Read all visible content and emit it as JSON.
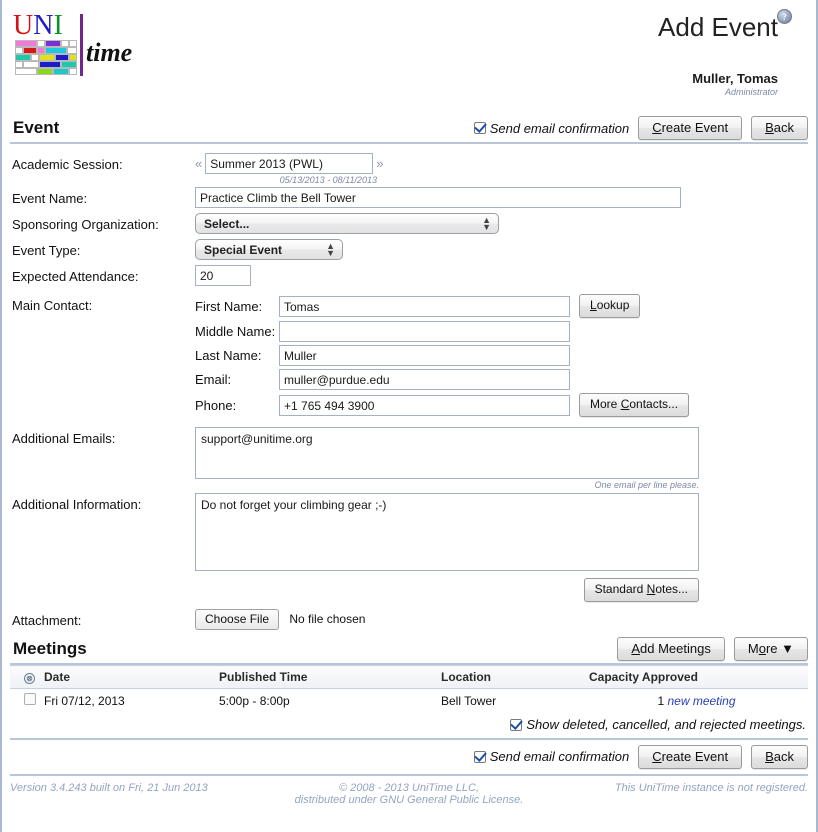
{
  "header": {
    "logo_uni": [
      "U",
      "N",
      "I"
    ],
    "logo_time": "time",
    "page_title": "Add Event",
    "help_icon_glyph": "?",
    "user_name": "Muller, Tomas",
    "user_role": "Administrator"
  },
  "event_section": {
    "title": "Event",
    "send_email_label": "Send email confirmation",
    "send_email_checked": true,
    "create_button": "Create Event",
    "create_button_accel": "C",
    "back_button": "Back",
    "back_button_accel": "B"
  },
  "form": {
    "academic_session": {
      "label": "Academic Session:",
      "value": "Summer 2013 (PWL)",
      "prev_glyph": "«",
      "next_glyph": "»",
      "dates": "05/13/2013 - 08/11/2013"
    },
    "event_name": {
      "label": "Event Name:",
      "value": "Practice Climb the Bell Tower"
    },
    "sponsoring_org": {
      "label": "Sponsoring Organization:",
      "value": "Select..."
    },
    "event_type": {
      "label": "Event Type:",
      "value": "Special Event"
    },
    "expected_attendance": {
      "label": "Expected Attendance:",
      "value": "20"
    },
    "main_contact": {
      "label": "Main Contact:",
      "first_name_label": "First Name:",
      "first_name_value": "Tomas",
      "middle_name_label": "Middle Name:",
      "middle_name_value": "",
      "last_name_label": "Last Name:",
      "last_name_value": "Muller",
      "email_label": "Email:",
      "email_value": "muller@purdue.edu",
      "phone_label": "Phone:",
      "phone_value": "+1 765 494 3900",
      "lookup_button": "Lookup",
      "lookup_accel": "L",
      "more_contacts_button": "More Contacts...",
      "more_contacts_accel": "C"
    },
    "additional_emails": {
      "label": "Additional Emails:",
      "value": "support@unitime.org",
      "hint": "One email per line please."
    },
    "additional_information": {
      "label": "Additional Information:",
      "value": "Do not forget your climbing gear ;-)"
    },
    "standard_notes_button": "Standard Notes...",
    "standard_notes_accel": "N",
    "attachment": {
      "label": "Attachment:",
      "choose_button": "Choose File",
      "file_status": "No file chosen"
    }
  },
  "meetings": {
    "title": "Meetings",
    "add_button": "Add Meetings",
    "add_accel": "A",
    "more_button": "More",
    "more_accel": "o",
    "more_caret": "▼",
    "select_all_glyph": "⊗",
    "columns": [
      "Date",
      "Published Time",
      "Location",
      "Capacity Approved"
    ],
    "rows": [
      {
        "checked": false,
        "date": "Fri 07/12, 2013",
        "published_time": "5:00p - 8:00p",
        "location": "Bell Tower",
        "capacity": "1",
        "approval": "new meeting"
      }
    ],
    "show_deleted_label": "Show deleted, cancelled, and rejected meetings.",
    "show_deleted_checked": true
  },
  "bottom_bar": {
    "send_email_label": "Send email confirmation",
    "send_email_checked": true,
    "create_button": "Create Event",
    "create_button_accel": "C",
    "back_button": "Back",
    "back_button_accel": "B"
  },
  "footer": {
    "version": "Version 3.4.243 built on Fri, 21 Jun 2013",
    "copyright_line1": "© 2008 - 2013 UniTime LLC,",
    "copyright_line2": "distributed under GNU General Public License.",
    "registration": "This UniTime instance is not registered."
  },
  "colors": {
    "rule": "#b9c6da",
    "input_border": "#a3b1c6",
    "muted_text": "#93a4c2",
    "link": "#2a3fb8"
  }
}
